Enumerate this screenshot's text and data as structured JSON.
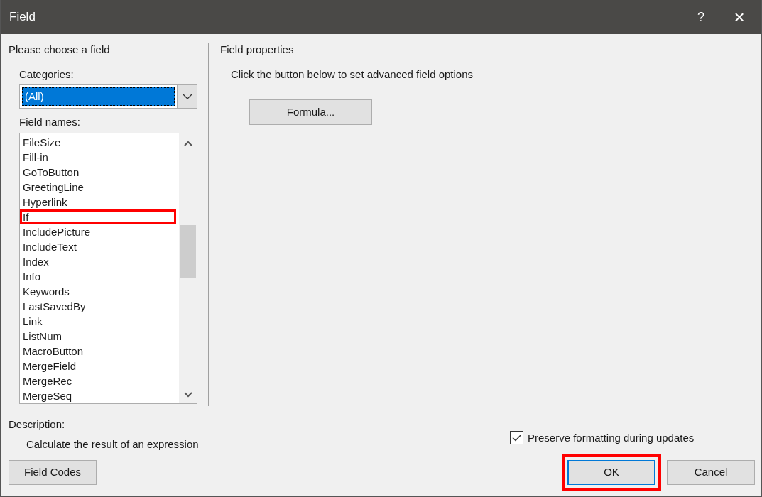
{
  "window": {
    "title": "Field",
    "help": "?",
    "close": "×"
  },
  "choose": {
    "heading": "Please choose a field",
    "categories_label": "Categories:",
    "category": {
      "value": "(All)",
      "selected": true
    },
    "field_names_label": "Field names:",
    "field_names": [
      {
        "label": "FileSize",
        "annotated": false
      },
      {
        "label": "Fill-in",
        "annotated": false
      },
      {
        "label": "GoToButton",
        "annotated": false
      },
      {
        "label": "GreetingLine",
        "annotated": false
      },
      {
        "label": "Hyperlink",
        "annotated": false
      },
      {
        "label": "If",
        "annotated": true
      },
      {
        "label": "IncludePicture",
        "annotated": false
      },
      {
        "label": "IncludeText",
        "annotated": false
      },
      {
        "label": "Index",
        "annotated": false
      },
      {
        "label": "Info",
        "annotated": false
      },
      {
        "label": "Keywords",
        "annotated": false
      },
      {
        "label": "LastSavedBy",
        "annotated": false
      },
      {
        "label": "Link",
        "annotated": false
      },
      {
        "label": "ListNum",
        "annotated": false
      },
      {
        "label": "MacroButton",
        "annotated": false
      },
      {
        "label": "MergeField",
        "annotated": false
      },
      {
        "label": "MergeRec",
        "annotated": false
      },
      {
        "label": "MergeSeq",
        "annotated": false
      }
    ],
    "description_label": "Description:",
    "description": "Calculate the result of an expression"
  },
  "properties": {
    "heading": "Field properties",
    "hint": "Click the button below to set advanced field options",
    "formula_button": "Formula...",
    "preserve": {
      "label": "Preserve formatting during updates",
      "checked": true
    }
  },
  "buttons": [
    {
      "label": "Field Codes",
      "kind": "left",
      "annotated": false
    },
    {
      "label": "OK",
      "kind": "default",
      "annotated": true
    },
    {
      "label": "Cancel",
      "kind": "normal",
      "annotated": false
    }
  ]
}
